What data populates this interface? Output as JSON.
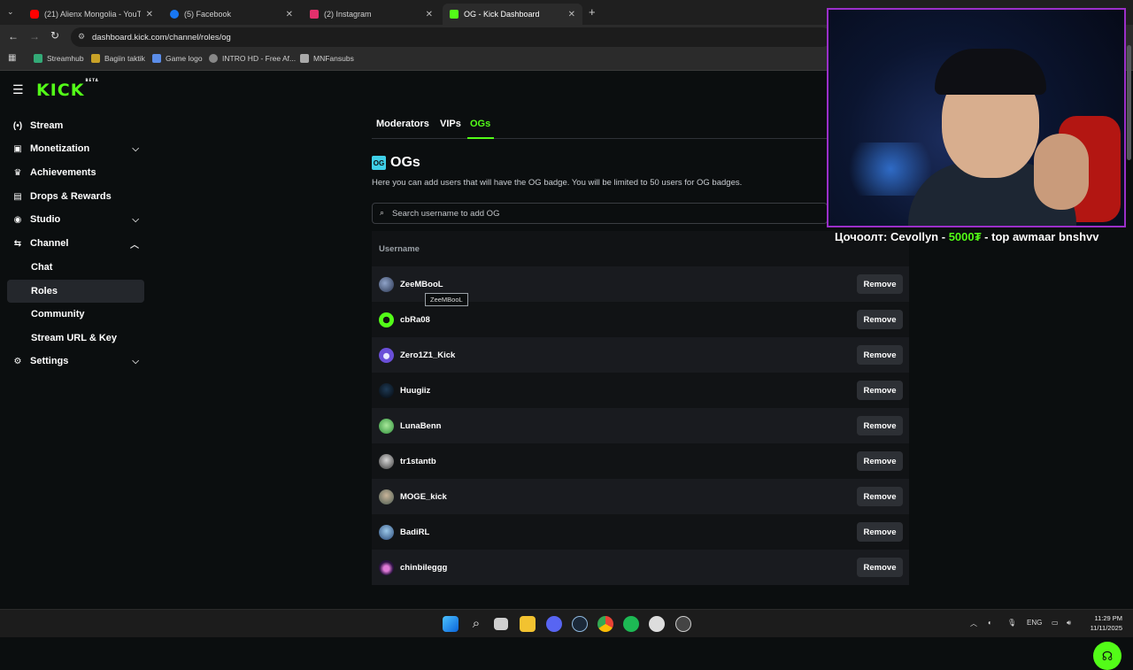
{
  "browser": {
    "tabs": [
      {
        "title": "(21) Alienx Mongolia - YouTube",
        "color": "#ff0000"
      },
      {
        "title": "(5) Facebook",
        "color": "#1877f2"
      },
      {
        "title": "(2) Instagram",
        "color": "#e1306c"
      },
      {
        "title": "OG - Kick Dashboard",
        "color": "#53fc18"
      }
    ],
    "url": "dashboard.kick.com/channel/roles/og",
    "bookmarks": [
      "Streamhub",
      "Bagiin taktik",
      "Game logo",
      "INTRO HD - Free Af...",
      "MNFansubs"
    ]
  },
  "app": {
    "logo": "KICK",
    "logo_badge": "BETA",
    "brand_color": "#53fc18"
  },
  "sidebar": {
    "items": [
      {
        "label": "Stream",
        "icon": "broadcast-icon"
      },
      {
        "label": "Monetization",
        "icon": "money-icon"
      },
      {
        "label": "Achievements",
        "icon": "trophy-icon"
      },
      {
        "label": "Drops & Rewards",
        "icon": "gift-icon"
      },
      {
        "label": "Studio",
        "icon": "studio-icon"
      },
      {
        "label": "Channel",
        "icon": "channel-icon"
      },
      {
        "label": "Chat"
      },
      {
        "label": "Roles"
      },
      {
        "label": "Community"
      },
      {
        "label": "Stream URL & Key"
      },
      {
        "label": "Settings",
        "icon": "gear-icon"
      }
    ]
  },
  "roles_tabs": [
    "Moderators",
    "VIPs",
    "OGs"
  ],
  "og": {
    "title": "OGs",
    "description": "Here you can add users that will have the OG badge. You will be limited to 50 users for OG badges.",
    "search_placeholder": "Search username to add OG",
    "column_username": "Username",
    "remove_label": "Remove",
    "tooltip": "ZeeMBooL",
    "users": [
      {
        "name": "ZeeMBooL"
      },
      {
        "name": "cbRa08"
      },
      {
        "name": "Zero1Z1_Kick"
      },
      {
        "name": "Huugiiz"
      },
      {
        "name": "LunaBenn"
      },
      {
        "name": "tr1stantb"
      },
      {
        "name": "MOGE_kick"
      },
      {
        "name": "BadiRL"
      },
      {
        "name": "chinbileggg"
      }
    ]
  },
  "overlay": {
    "donation_prefix": "Цочоолт: Cevollyn - ",
    "donation_amount": "5000₮",
    "donation_suffix": " - top awmaar bnshvv"
  },
  "taskbar": {
    "lang": "ENG",
    "time": "11:29 PM",
    "date": "11/11/2025"
  }
}
